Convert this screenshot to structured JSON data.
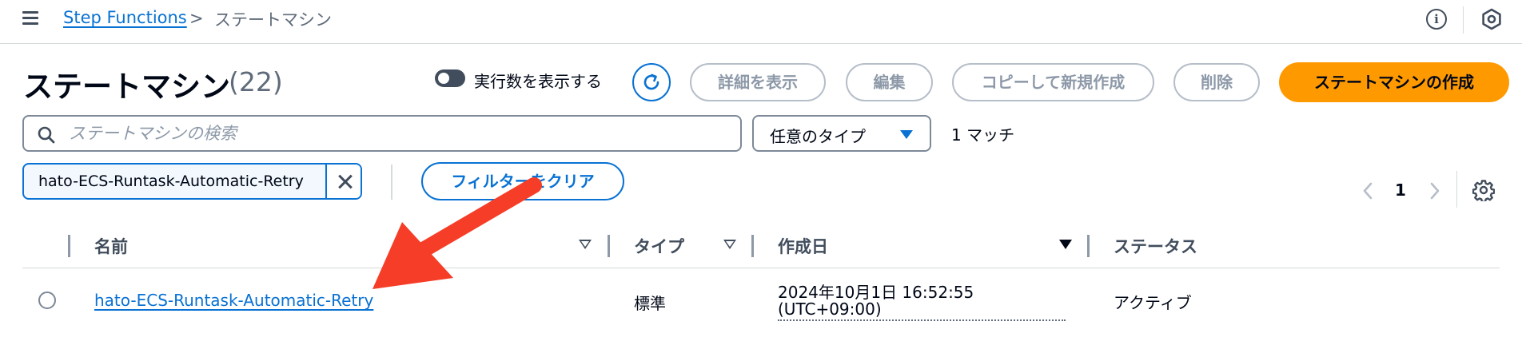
{
  "breadcrumb": {
    "service": "Step Functions",
    "separator": ">",
    "current": "ステートマシン"
  },
  "page": {
    "title": "ステートマシン",
    "count": "(22)"
  },
  "toggle": {
    "label": "実行数を表示する",
    "on": false
  },
  "actions": {
    "details": "詳細を表示",
    "edit": "編集",
    "copy": "コピーして新規作成",
    "delete": "削除",
    "create": "ステートマシンの作成"
  },
  "search": {
    "placeholder": "ステートマシンの検索",
    "value": ""
  },
  "type_filter": {
    "selected": "任意のタイプ"
  },
  "match_count": "1 マッチ",
  "filter_token": {
    "value": "hato-ECS-Runtask-Automatic-Retry"
  },
  "clear_filter": "フィルターをクリア",
  "pagination": {
    "current_page": "1"
  },
  "table": {
    "columns": [
      "名前",
      "タイプ",
      "作成日",
      "ステータス"
    ],
    "rows": [
      {
        "name": "hato-ECS-Runtask-Automatic-Retry",
        "type": "標準",
        "created_line1": "2024年10月1日 16:52:55",
        "created_line2": "(UTC+09:00)",
        "status": "アクティブ"
      }
    ]
  },
  "colors": {
    "link": "#0972d3",
    "primary_button": "#ff9900",
    "annotation_arrow": "#f53d27"
  },
  "icons": {
    "menu": "hamburger-icon",
    "info": "info-icon",
    "settings": "hexagon-settings-icon",
    "refresh": "refresh-icon",
    "search": "search-icon",
    "dropdown": "caret-down-icon",
    "remove": "close-icon",
    "prev": "chevron-left-icon",
    "next": "chevron-right-icon",
    "preferences": "gear-icon"
  }
}
